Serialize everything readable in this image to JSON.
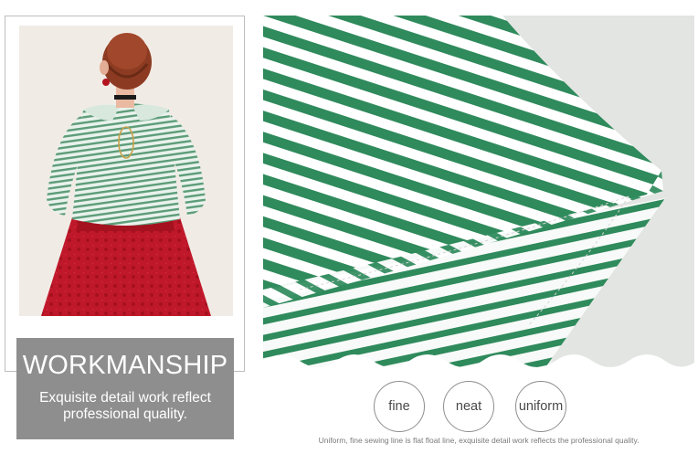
{
  "workmanship": {
    "title": "WORKMANSHIP",
    "line1": "Exquisite detail work reflect",
    "line2": "professional quality."
  },
  "tags": [
    "fine",
    "neat",
    "uniform"
  ],
  "caption": "Uniform, fine sewing line is flat float line, exquisite detail work reflects the professional quality.",
  "colors": {
    "stripe_green": "#2f8a5c",
    "skirt_red": "#c0182b",
    "panel_gray": "#8e8e8e"
  }
}
